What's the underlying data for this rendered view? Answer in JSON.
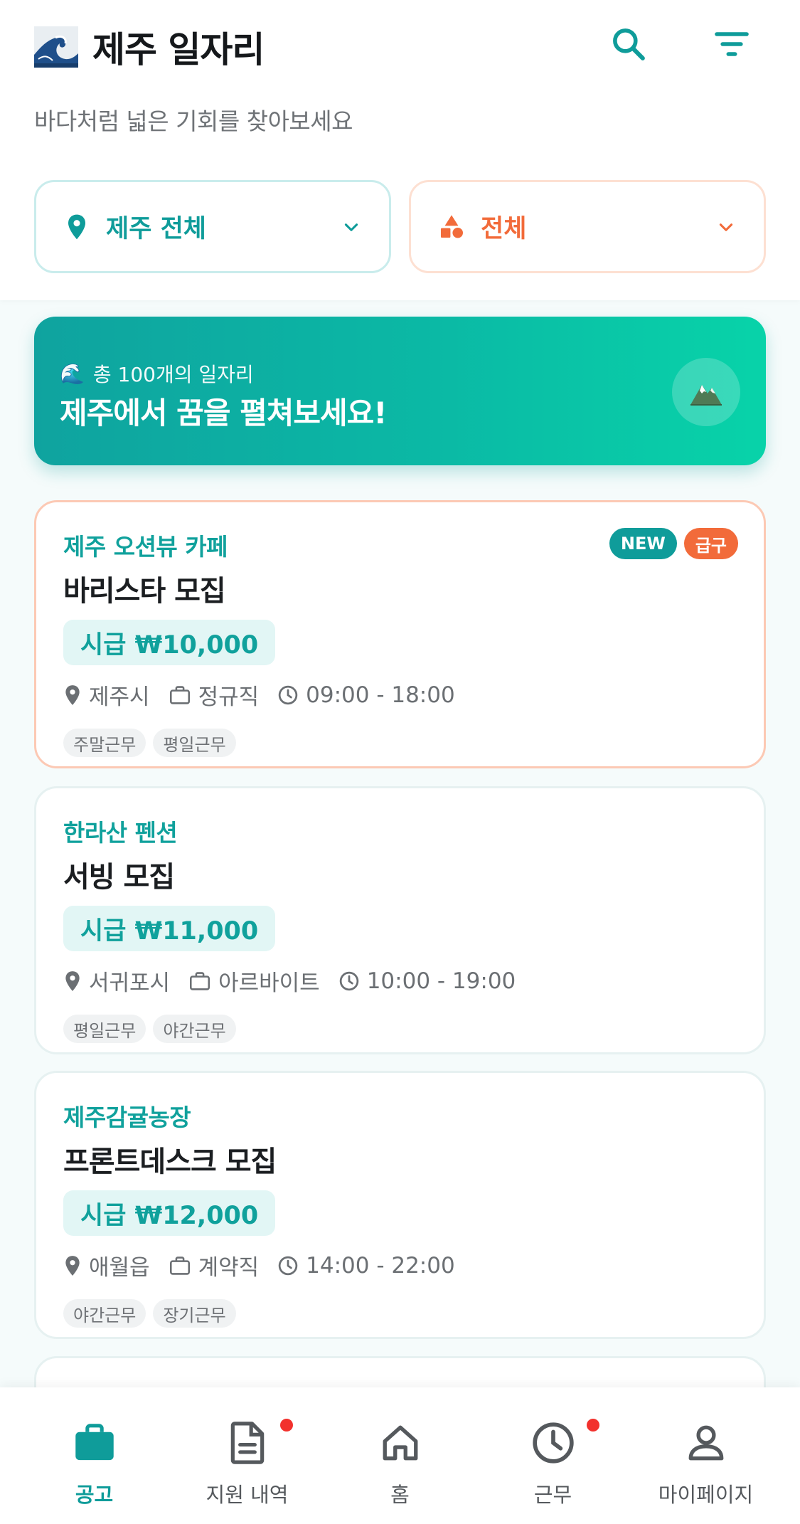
{
  "header": {
    "logo_emoji": "🌊",
    "title": "제주 일자리",
    "subtitle": "바다처럼 넓은 기회를 찾아보세요",
    "search_icon": "search-icon",
    "filter_icon": "filter-icon"
  },
  "filters": {
    "region": {
      "label": "제주 전체",
      "icon": "location-pin-icon"
    },
    "category": {
      "label": "전체",
      "icon": "shapes-icon"
    }
  },
  "banner": {
    "wave_emoji": "🌊",
    "subtitle": "총 100개의 일자리",
    "title": "제주에서 꿈을 펼쳐보세요!",
    "mountain_emoji": "🏔️"
  },
  "jobs": [
    {
      "company": "제주 오션뷰 카페",
      "title": "바리스타 모집",
      "wage": "시급 ₩10,000",
      "location": "제주시",
      "type": "정규직",
      "hours": "09:00 - 18:00",
      "tags": [
        "주말근무",
        "평일근무"
      ],
      "badges": {
        "new": "NEW",
        "urgent": "급구"
      }
    },
    {
      "company": "한라산 펜션",
      "title": "서빙 모집",
      "wage": "시급 ₩11,000",
      "location": "서귀포시",
      "type": "아르바이트",
      "hours": "10:00 - 19:00",
      "tags": [
        "평일근무",
        "야간근무"
      ]
    },
    {
      "company": "제주감귤농장",
      "title": "프론트데스크 모집",
      "wage": "시급 ₩12,000",
      "location": "애월읍",
      "type": "계약직",
      "hours": "14:00 - 22:00",
      "tags": [
        "야간근무",
        "장기근무"
      ]
    }
  ],
  "nav": {
    "items": [
      {
        "label": "공고",
        "icon": "briefcase-icon",
        "active": true
      },
      {
        "label": "지원 내역",
        "icon": "document-icon",
        "notification": true
      },
      {
        "label": "홈",
        "icon": "home-icon"
      },
      {
        "label": "근무",
        "icon": "clock-icon",
        "notification": true
      },
      {
        "label": "마이페이지",
        "icon": "person-icon"
      }
    ]
  },
  "colors": {
    "primary": "#0f9c9a",
    "accent": "#f26b3a",
    "notification": "#f2312d"
  }
}
